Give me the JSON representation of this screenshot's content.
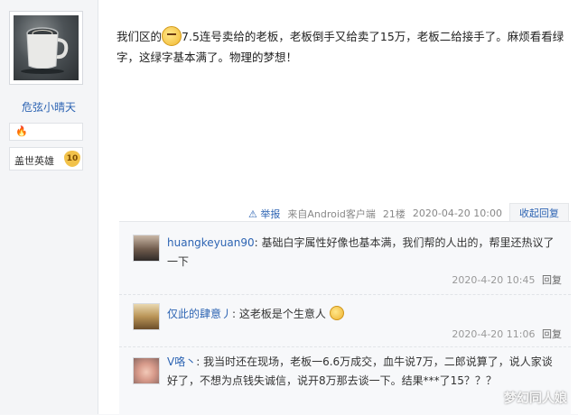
{
  "author": {
    "name": "危弦小晴天",
    "badge_icon": "flame-badge-icon",
    "level_title": "盖世英雄",
    "level_number": "10"
  },
  "post": {
    "text_before_emoji": "我们区的",
    "text_after_emoji": "7.5连号卖给的老板，老板倒手又给卖了15万，老板二给接手了。麻烦看看绿字，这绿字基本满了。物理的梦想！"
  },
  "post_meta": {
    "report_label": "举报",
    "source": "来自Android客户端",
    "floor": "21楼",
    "datetime": "2020-04-20 10:00",
    "collapse_reply_label": "收起回复"
  },
  "replies": [
    {
      "user": "huangkeyuan90",
      "text": "基础白字属性好像也基本满，我们帮的人出的，帮里还热议了一下",
      "time": "2020-4-20 10:45",
      "reply_label": "回复"
    },
    {
      "user": "仅此的肆意丿",
      "text": "这老板是个生意人",
      "time": "2020-4-20 11:06",
      "reply_label": "回复"
    },
    {
      "user": "V咯丶",
      "text": "我当时还在现场，老板一6.6万成交，血牛说7万，二郎说算了，说人家谈好了，不想为点钱失诚信，说开8万那去谈一下。结果***了15？？？",
      "time": "",
      "reply_label": ""
    }
  ],
  "watermark": "梦幻同人娘",
  "colors": {
    "link_blue": "#2d64b3",
    "badge_gold": "#f2c24a",
    "reply_area_bg": "#f7f8fa"
  }
}
